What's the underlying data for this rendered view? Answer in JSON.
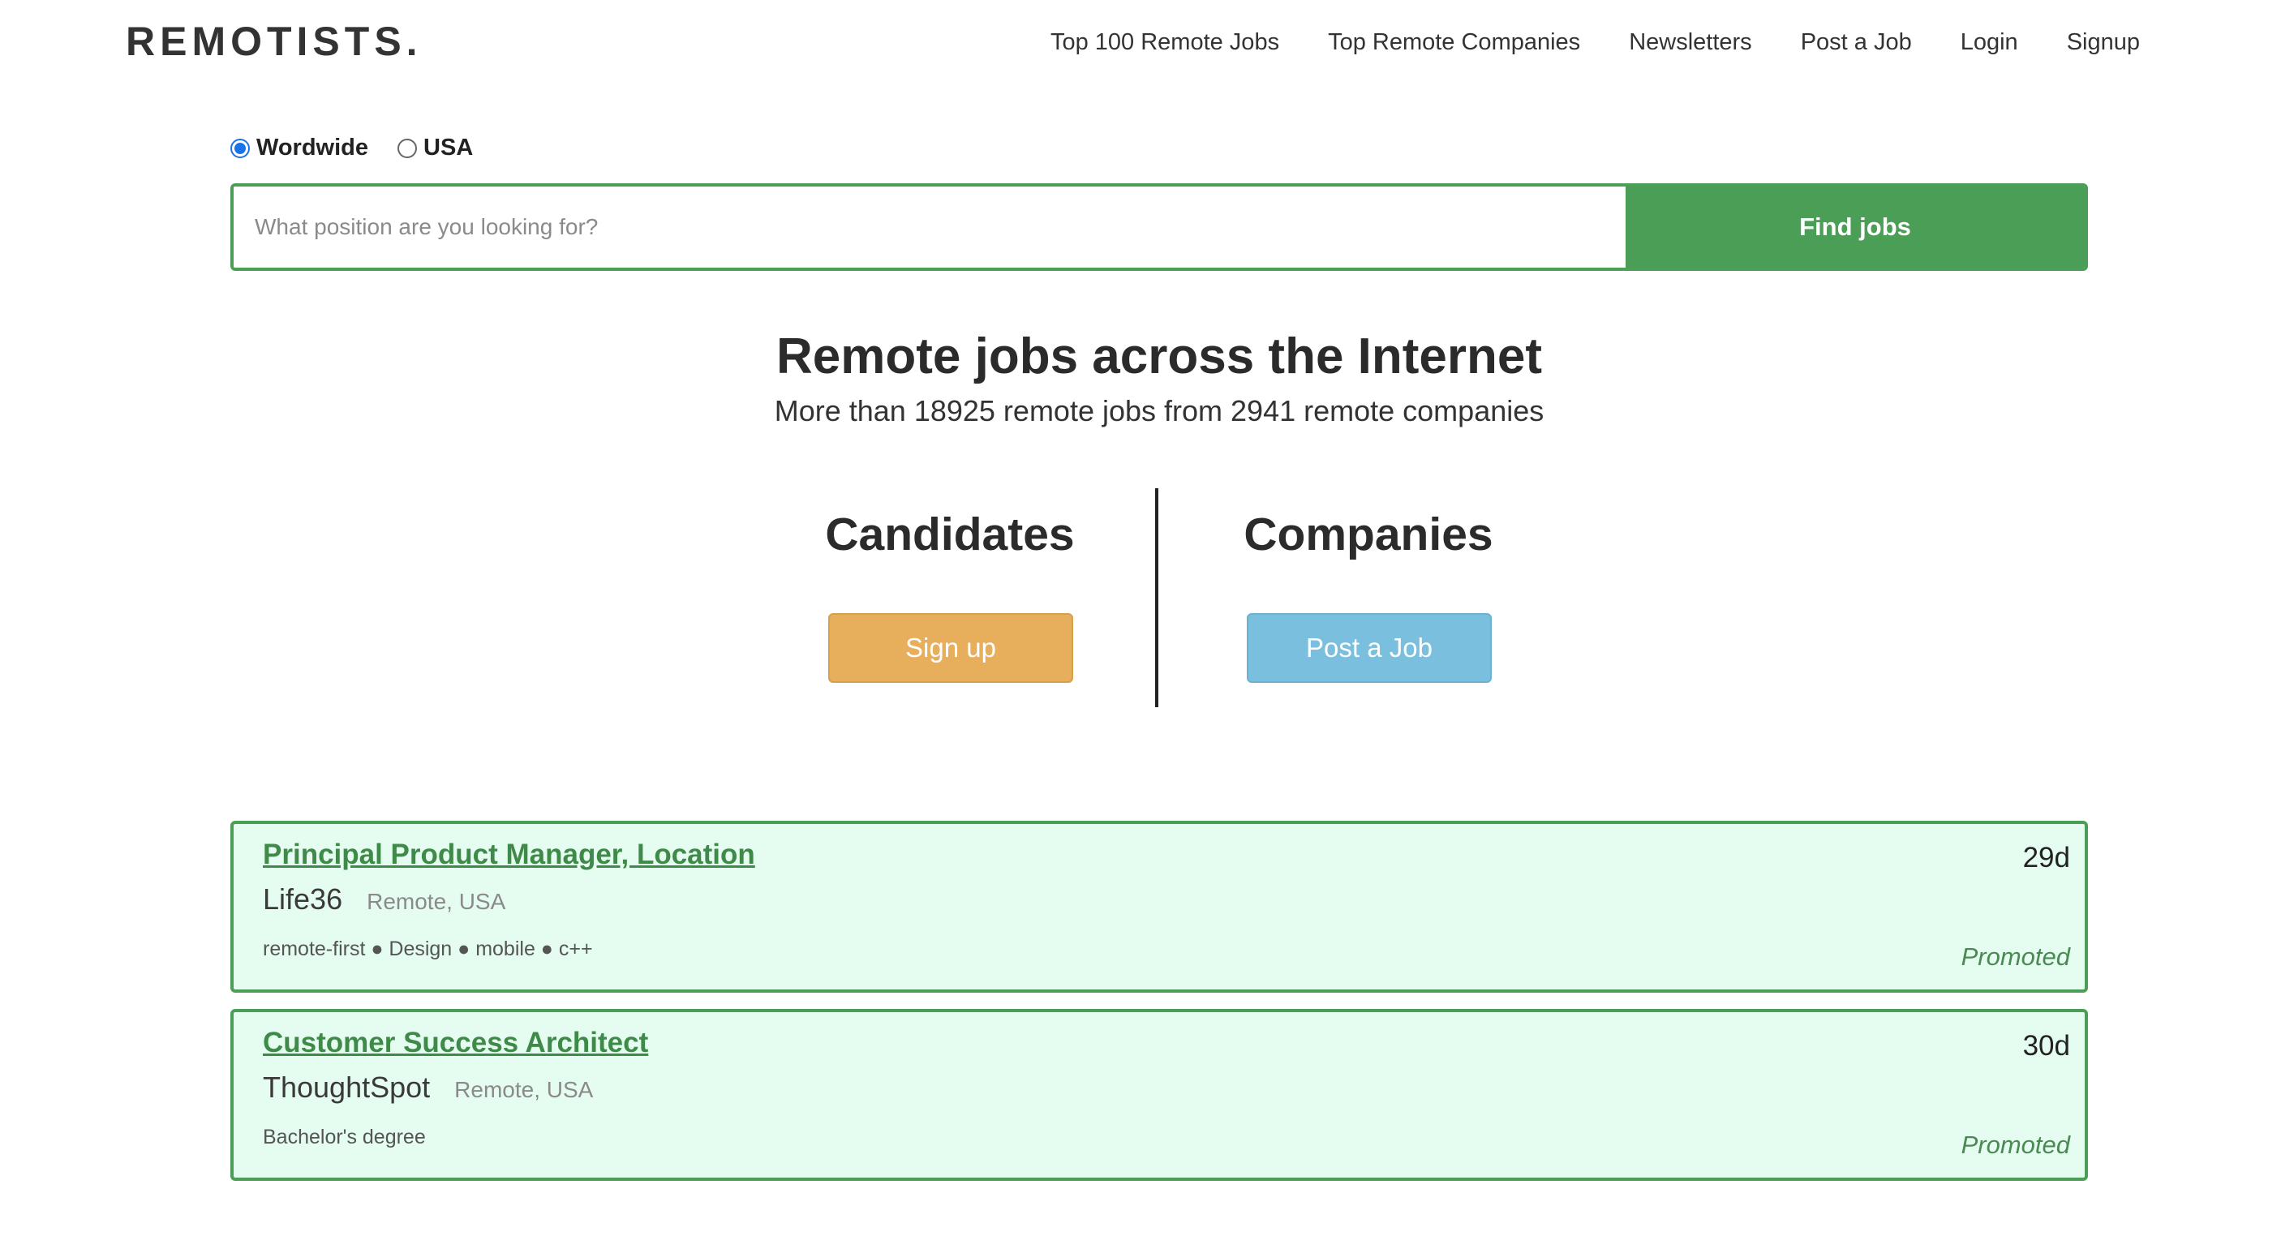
{
  "header": {
    "logo": "REMOTISTS.",
    "nav": [
      {
        "label": "Top 100 Remote Jobs"
      },
      {
        "label": "Top Remote Companies"
      },
      {
        "label": "Newsletters"
      },
      {
        "label": "Post a Job"
      },
      {
        "label": "Login"
      },
      {
        "label": "Signup"
      }
    ]
  },
  "search": {
    "regions": [
      {
        "label": "Wordwide",
        "checked": true
      },
      {
        "label": "USA",
        "checked": false
      }
    ],
    "value": "",
    "placeholder": "What position are you looking for?",
    "button_label": "Find jobs"
  },
  "hero": {
    "title": "Remote jobs across the Internet",
    "subtitle": "More than 18925 remote jobs from 2941 remote companies"
  },
  "split": {
    "candidates": {
      "heading": "Candidates",
      "button_label": "Sign up"
    },
    "companies": {
      "heading": "Companies",
      "button_label": "Post a Job"
    }
  },
  "jobs": [
    {
      "title": "Principal Product Manager, Location",
      "company": "Life36",
      "location": "Remote, USA",
      "tags": "remote-first ● Design ● mobile ● c++",
      "age": "29d",
      "promoted": "Promoted"
    },
    {
      "title": "Customer Success Architect",
      "company": "ThoughtSpot",
      "location": "Remote, USA",
      "tags": "Bachelor's degree",
      "age": "30d",
      "promoted": "Promoted"
    }
  ],
  "colors": {
    "brand_green": "#4a9e56",
    "job_card_bg": "#e4fdf0",
    "signup_orange": "#e7ae5b",
    "post_blue": "#7bbfdf"
  }
}
